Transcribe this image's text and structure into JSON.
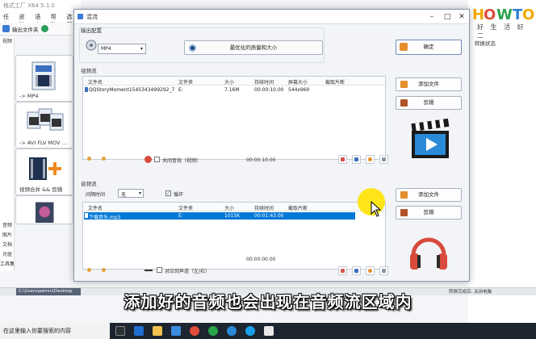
{
  "bg_app": {
    "title": "格式工厂 X64 5.1.0",
    "menu": [
      "任务",
      "皮肤",
      "语言",
      "帮助",
      "选项"
    ],
    "toolbar_label": "输出文件夹",
    "sidebar_items": [
      "视频",
      "音频",
      "图片",
      "文档",
      "光驱",
      "工具集"
    ],
    "tiles": [
      {
        "label": "-> MP4"
      },
      {
        "label": "-> AVI FLV MOV ..."
      },
      {
        "label": "视频合并 && 剪辑"
      },
      {
        "label": ""
      }
    ],
    "right_panel_text": "转换状态",
    "logo_text": "HOWTO",
    "logo_sub": "好 生 活 好 二",
    "status_path": "C:\\Users\\admin\\Desktop",
    "status_right": "转换完成后: 关闭电脑"
  },
  "dialog": {
    "title": "混流",
    "output_config_label": "输出配置",
    "format_value": "MP4",
    "quality_button": "最优化的质量和大小",
    "ok_button": "确定",
    "video_stream": {
      "label": "视频流",
      "columns": [
        "文件名",
        "文件夹",
        "大小",
        "持续时间",
        "屏幕大小",
        "截取片断"
      ],
      "rows": [
        {
          "name": "QQStoryMoment1545343499292_7488...",
          "folder": "E:",
          "size": "7.16M",
          "duration": "00:00:10.00",
          "screen": "544x960",
          "clip": ""
        }
      ],
      "add_button": "添加文件",
      "clip_button": "剪辑",
      "mute_label": "关闭音效（视频）",
      "duration_total": "00:00:10.00"
    },
    "audio_stream": {
      "label": "音频流",
      "interval_label": "间隔时间",
      "interval_value": "无",
      "loop_label": "循环",
      "columns": [
        "文件名",
        "文件夹",
        "大小",
        "持续时间",
        "截取片断"
      ],
      "rows": [
        {
          "name": "下载音乐.mp3",
          "folder": "E:",
          "size": "1015K",
          "duration": "00:01:43.00",
          "clip": ""
        }
      ],
      "add_button": "添加文件",
      "clip_button": "剪辑",
      "align_label": "对应到声道（左/右）",
      "duration_total": "00:00:00.00"
    }
  },
  "subtitle": "添加好的音频也会出现在音频流区域内",
  "taskbar": {
    "search_placeholder": "在这里输入你要搜索的内容"
  },
  "colors": {
    "accent_blue": "#1e6fcf",
    "selection_blue": "#0078d7",
    "cursor_halo": "#ffe200",
    "subtitle_text": "#ffffff"
  }
}
